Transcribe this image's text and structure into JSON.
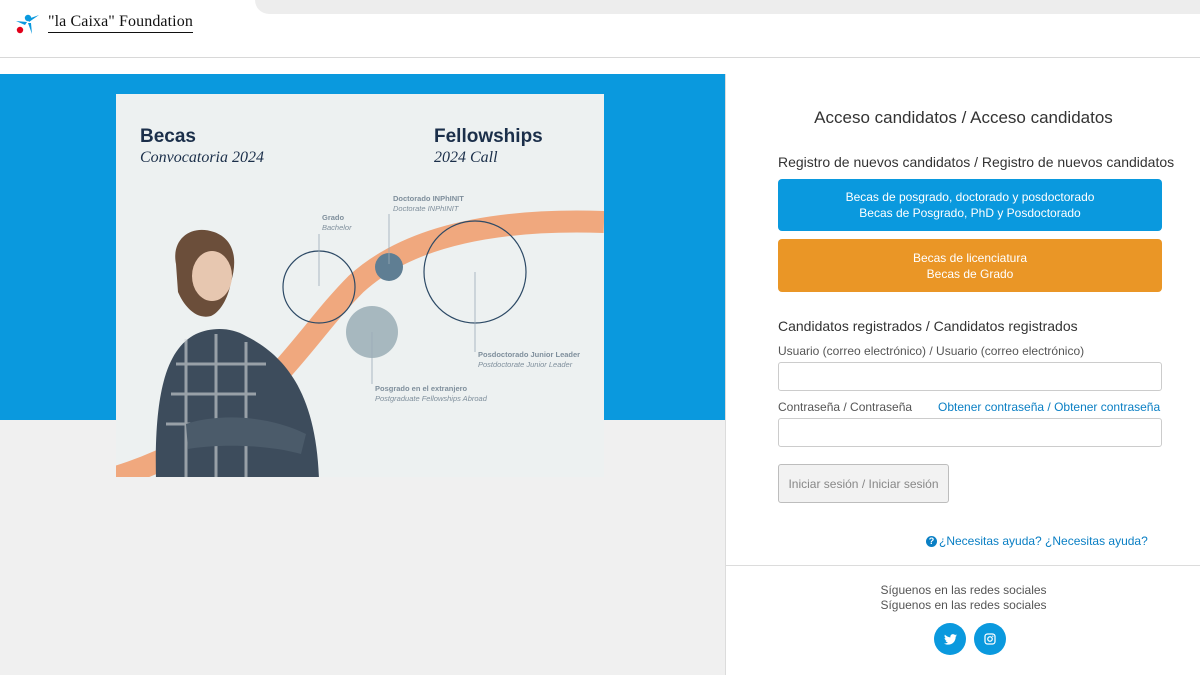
{
  "header": {
    "logo_text": "\"la Caixa\" Foundation"
  },
  "poster": {
    "left_title": "Becas",
    "left_subtitle": "Convocatoria 2024",
    "right_title": "Fellowships",
    "right_subtitle": "2024 Call",
    "labels": {
      "grado": [
        "Grado",
        "Bachelor"
      ],
      "doctorado": [
        "Doctorado INPhINIT",
        "Doctorate INPhINIT"
      ],
      "posdoctorado": [
        "Posdoctorado Junior Leader",
        "Postdoctorate Junior Leader"
      ],
      "posgrado": [
        "Posgrado en el extranjero",
        "Postgraduate Fellowships Abroad"
      ]
    }
  },
  "form": {
    "title": "Acceso candidatos / Acceso candidatos",
    "new_candidates_title": "Registro de nuevos candidatos / Registro de nuevos candidatos",
    "btn_postgrad_line1": "Becas de posgrado, doctorado y posdoctorado",
    "btn_postgrad_line2": "Becas de Posgrado, PhD y Posdoctorado",
    "btn_bachelor_line1": "Becas de licenciatura",
    "btn_bachelor_line2": "Becas de Grado",
    "registered_title": "Candidatos registrados / Candidatos registrados",
    "user_label": "Usuario (correo electrónico) / Usuario (correo electrónico)",
    "user_value": "",
    "password_label": "Contraseña / Contraseña",
    "password_value": "",
    "get_password_link": "Obtener contraseña / Obtener contraseña",
    "login_button": "Iniciar sesión / Iniciar sesión",
    "help_link": "¿Necesitas ayuda? ¿Necesitas ayuda?"
  },
  "footer": {
    "follow_line1": "Síguenos en las redes sociales",
    "follow_line2": "Síguenos en las redes sociales",
    "icons": [
      "twitter-icon",
      "instagram-icon"
    ]
  },
  "colors": {
    "accent_blue": "#0a99de",
    "accent_orange": "#ea9626",
    "link": "#0a7fc4"
  }
}
